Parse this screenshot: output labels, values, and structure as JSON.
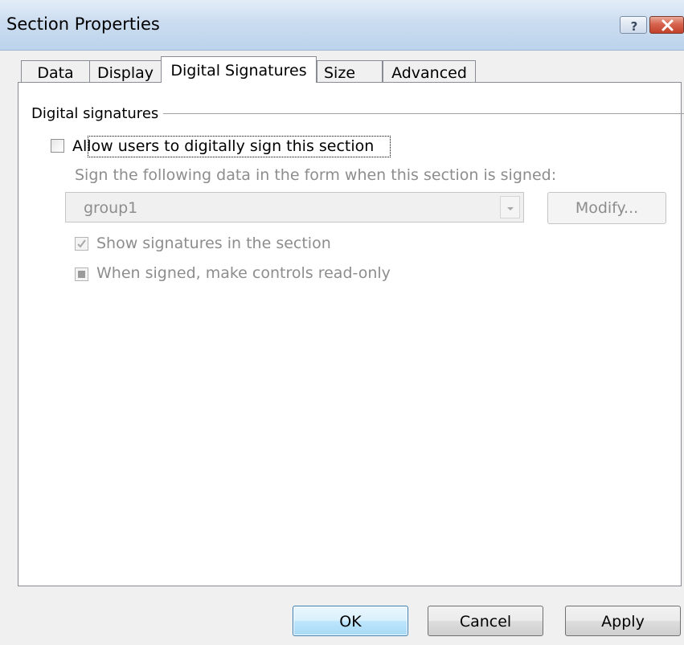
{
  "window": {
    "title": "Section Properties",
    "help_icon": "help-question-icon",
    "help_label": "?",
    "close_icon": "close-x-icon"
  },
  "tabs": [
    {
      "label": "Data",
      "active": false
    },
    {
      "label": "Display",
      "active": false
    },
    {
      "label": "Digital Signatures",
      "active": true
    },
    {
      "label": "Size",
      "active": false
    },
    {
      "label": "Advanced",
      "active": false
    }
  ],
  "panel": {
    "group_label": "Digital signatures",
    "allow_sign": {
      "label": "Allow users to digitally sign this section",
      "checked": false,
      "enabled": true
    },
    "sign_data_label": "Sign the following data in the form when this section is signed:",
    "sign_data_select": {
      "value": "group1",
      "enabled": false
    },
    "modify_button": "Modify...",
    "show_signatures": {
      "label": "Show signatures in the section",
      "checked": true,
      "enabled": false
    },
    "read_only": {
      "label": "When signed, make controls read-only",
      "state": "indeterminate",
      "enabled": false
    }
  },
  "footer": {
    "ok_label": "OK",
    "cancel_label": "Cancel",
    "apply_label": "Apply"
  },
  "colors": {
    "titlebar": "#cbdcef",
    "dialog_bg": "#f0f0f0",
    "panel_bg": "#ffffff",
    "disabled_text": "#8d8d8d",
    "default_button_border": "#3c7fb1"
  }
}
